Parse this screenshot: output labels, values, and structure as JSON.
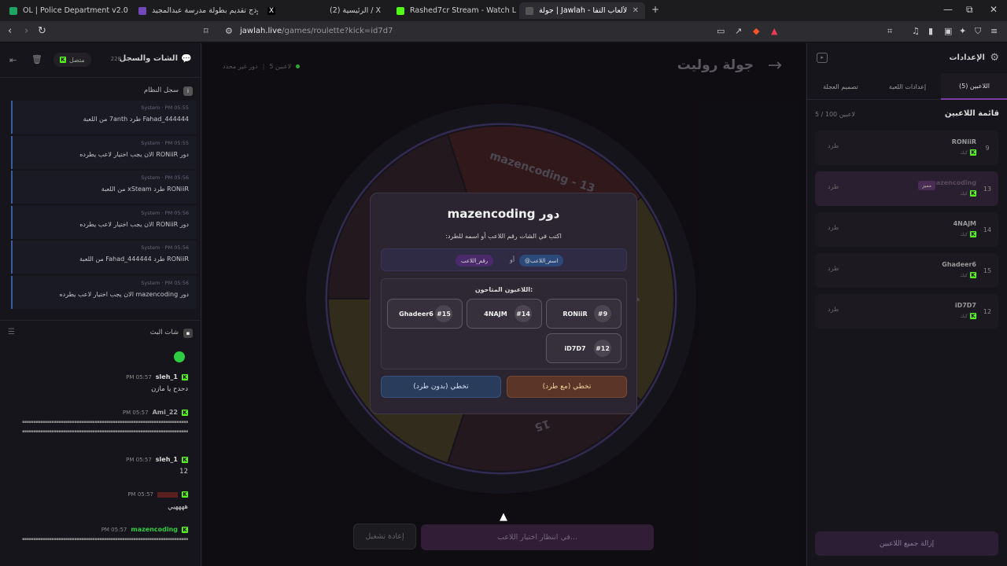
{
  "browser": {
    "tabs": [
      {
        "label": "OL | Police Department v2.0 - بيانات",
        "color": "#1ea362"
      },
      {
        "label": "نموذج تقديم بطولة مدرسة عبدالمجيد",
        "color": "#7248b9"
      },
      {
        "label": "(2) الرئيسية / X",
        "color": "#000000"
      },
      {
        "label": "Rashed7cr Stream - Watch Live on Ki",
        "color": "#53fc18"
      },
      {
        "label": "جولة | Jawlah - منصة الألعاب التفا",
        "color": "#2a2a2a"
      }
    ],
    "tab_x": "X",
    "new_tab": "+",
    "url_host": "jawlah.live",
    "url_path": "/games/roulette?kick=id7d7"
  },
  "left": {
    "title": "الشات والسجل",
    "count": "228",
    "status": "متصل",
    "syslog_title": "سجل النظام",
    "syslog": [
      {
        "meta": "System · PM 05:55",
        "msg": "Fahad_444444 طرد 7anth من اللعبة"
      },
      {
        "meta": "System · PM 05:55",
        "msg": "دور RONiiR الان يجب اختيار لاعب يطرده"
      },
      {
        "meta": "System · PM 05:56",
        "msg": "RONiiR طرد xSteam من اللعبة"
      },
      {
        "meta": "System · PM 05:56",
        "msg": "دور RONiiR الان يجب اختيار لاعب يطرده"
      },
      {
        "meta": "System · PM 05:56",
        "msg": "RONiiR طرد Fahad_444444 من اللعبة"
      },
      {
        "meta": "System · PM 05:56",
        "msg": "دور mazencoding الان يجب اختيار لاعب يطرده"
      }
    ],
    "livechat_title": "شات البث",
    "chat": [
      {
        "name": "sleh_1",
        "time": "PM 05:57",
        "text": "دحدح يا مازن",
        "color": "#dddddd"
      },
      {
        "name": "Ami_22",
        "time": "PM 05:57",
        "text": "",
        "color": "#aaaaaa"
      },
      {
        "name": "sleh_1",
        "time": "PM 05:57",
        "text": "12",
        "color": "#dddddd"
      },
      {
        "name": "",
        "time": "PM 05:57",
        "text": "ههههيي",
        "color": "#c0392b"
      },
      {
        "name": "mazencoding",
        "time": "PM 05:57",
        "text": "",
        "color": "#2ecc40"
      }
    ]
  },
  "center": {
    "title": "جولة روليت",
    "players_count": "5 لاعبين",
    "turn_status": "دور غير محدد",
    "wheel_labels": [
      "mazencoding - 13",
      "4",
      "15",
      "12",
      "9"
    ],
    "restart": "إعادة تشغيل",
    "waiting": "في انتظار اختيار اللاعب..."
  },
  "modal": {
    "title": "دور mazencoding",
    "subtitle": "اكتب في الشات رقم اللاعب أو اسمه للطرد:",
    "chip_name": "@اسم_اللاعب",
    "or": "أو",
    "chip_number": "رقم_اللاعب",
    "available_title": "اللاعبون المتاحون:",
    "players": [
      {
        "num": "#9",
        "name": "RONiiR"
      },
      {
        "num": "#14",
        "name": "4NAJM"
      },
      {
        "num": "#15",
        "name": "Ghadeer6"
      },
      {
        "num": "#12",
        "name": "iD7D7"
      }
    ],
    "skip_kick": "تخطي (مع طرد)",
    "skip_no_kick": "تخطي (بدون طرد)"
  },
  "right": {
    "title": "الإعدادات",
    "tabs": [
      "اللاعبين (5)",
      "إعدادات اللعبة",
      "تصميم العجلة"
    ],
    "list_title": "قائمة اللاعبين",
    "list_count": "5 / 100 لاعبين",
    "players": [
      {
        "num": "9",
        "name": "RONiiR",
        "sub": "كيك",
        "kick": "طرد",
        "badge": ""
      },
      {
        "num": "13",
        "name": "mazencoding",
        "sub": "كيك",
        "kick": "طرد",
        "badge": "مميز"
      },
      {
        "num": "14",
        "name": "4NAJM",
        "sub": "كيك",
        "kick": "طرد",
        "badge": ""
      },
      {
        "num": "15",
        "name": "Ghadeer6",
        "sub": "كيك",
        "kick": "طرد",
        "badge": ""
      },
      {
        "num": "12",
        "name": "iD7D7",
        "sub": "كيك",
        "kick": "طرد",
        "badge": ""
      }
    ],
    "remove_all": "إزالة جميع اللاعبين"
  }
}
